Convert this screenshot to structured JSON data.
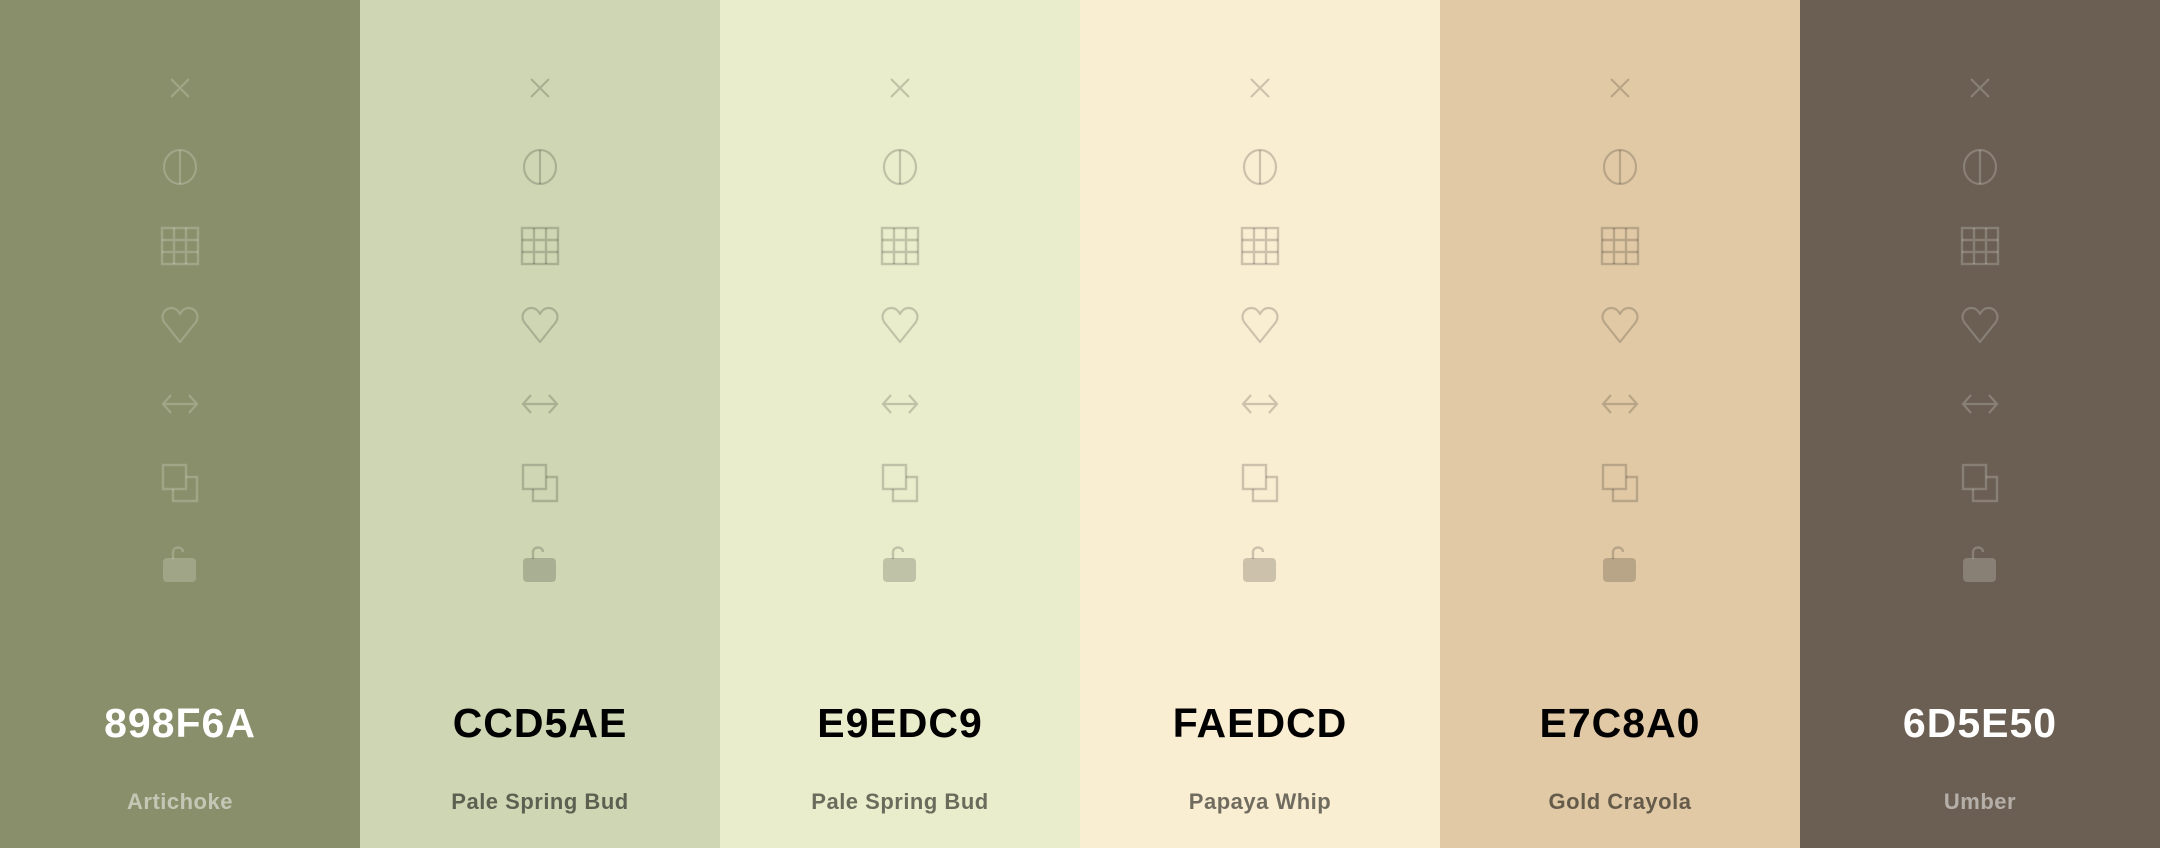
{
  "colors": [
    {
      "hex": "898F6A",
      "name": "Artichoke",
      "bg": "#898F6A",
      "theme": "dark"
    },
    {
      "hex": "CCD5AE",
      "name": "Pale Spring Bud",
      "bg": "#CFD6B3",
      "theme": "light"
    },
    {
      "hex": "E9EDC9",
      "name": "Pale Spring Bud",
      "bg": "#E9EDCB",
      "theme": "light"
    },
    {
      "hex": "FAEDCD",
      "name": "Papaya Whip",
      "bg": "#F9EDD2",
      "theme": "light"
    },
    {
      "hex": "E7C8A0",
      "name": "Gold Crayola",
      "bg": "#E1C9A5",
      "theme": "light"
    },
    {
      "hex": "6D5E50",
      "name": "Umber",
      "bg": "#6B5F53",
      "theme": "dark"
    }
  ],
  "icons": [
    "close-icon",
    "contrast-icon",
    "grid-icon",
    "heart-icon",
    "swap-arrows-icon",
    "copy-icon",
    "unlock-icon"
  ]
}
